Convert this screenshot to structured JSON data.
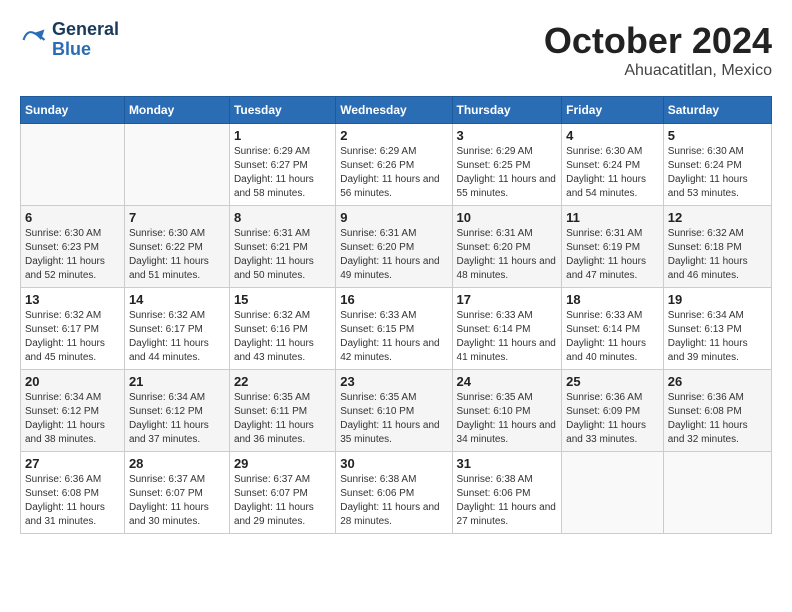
{
  "logo": {
    "line1": "General",
    "line2": "Blue"
  },
  "title": "October 2024",
  "subtitle": "Ahuacatitlan, Mexico",
  "headers": [
    "Sunday",
    "Monday",
    "Tuesday",
    "Wednesday",
    "Thursday",
    "Friday",
    "Saturday"
  ],
  "weeks": [
    [
      {
        "day": "",
        "info": ""
      },
      {
        "day": "",
        "info": ""
      },
      {
        "day": "1",
        "info": "Sunrise: 6:29 AM\nSunset: 6:27 PM\nDaylight: 11 hours and 58 minutes."
      },
      {
        "day": "2",
        "info": "Sunrise: 6:29 AM\nSunset: 6:26 PM\nDaylight: 11 hours and 56 minutes."
      },
      {
        "day": "3",
        "info": "Sunrise: 6:29 AM\nSunset: 6:25 PM\nDaylight: 11 hours and 55 minutes."
      },
      {
        "day": "4",
        "info": "Sunrise: 6:30 AM\nSunset: 6:24 PM\nDaylight: 11 hours and 54 minutes."
      },
      {
        "day": "5",
        "info": "Sunrise: 6:30 AM\nSunset: 6:24 PM\nDaylight: 11 hours and 53 minutes."
      }
    ],
    [
      {
        "day": "6",
        "info": "Sunrise: 6:30 AM\nSunset: 6:23 PM\nDaylight: 11 hours and 52 minutes."
      },
      {
        "day": "7",
        "info": "Sunrise: 6:30 AM\nSunset: 6:22 PM\nDaylight: 11 hours and 51 minutes."
      },
      {
        "day": "8",
        "info": "Sunrise: 6:31 AM\nSunset: 6:21 PM\nDaylight: 11 hours and 50 minutes."
      },
      {
        "day": "9",
        "info": "Sunrise: 6:31 AM\nSunset: 6:20 PM\nDaylight: 11 hours and 49 minutes."
      },
      {
        "day": "10",
        "info": "Sunrise: 6:31 AM\nSunset: 6:20 PM\nDaylight: 11 hours and 48 minutes."
      },
      {
        "day": "11",
        "info": "Sunrise: 6:31 AM\nSunset: 6:19 PM\nDaylight: 11 hours and 47 minutes."
      },
      {
        "day": "12",
        "info": "Sunrise: 6:32 AM\nSunset: 6:18 PM\nDaylight: 11 hours and 46 minutes."
      }
    ],
    [
      {
        "day": "13",
        "info": "Sunrise: 6:32 AM\nSunset: 6:17 PM\nDaylight: 11 hours and 45 minutes."
      },
      {
        "day": "14",
        "info": "Sunrise: 6:32 AM\nSunset: 6:17 PM\nDaylight: 11 hours and 44 minutes."
      },
      {
        "day": "15",
        "info": "Sunrise: 6:32 AM\nSunset: 6:16 PM\nDaylight: 11 hours and 43 minutes."
      },
      {
        "day": "16",
        "info": "Sunrise: 6:33 AM\nSunset: 6:15 PM\nDaylight: 11 hours and 42 minutes."
      },
      {
        "day": "17",
        "info": "Sunrise: 6:33 AM\nSunset: 6:14 PM\nDaylight: 11 hours and 41 minutes."
      },
      {
        "day": "18",
        "info": "Sunrise: 6:33 AM\nSunset: 6:14 PM\nDaylight: 11 hours and 40 minutes."
      },
      {
        "day": "19",
        "info": "Sunrise: 6:34 AM\nSunset: 6:13 PM\nDaylight: 11 hours and 39 minutes."
      }
    ],
    [
      {
        "day": "20",
        "info": "Sunrise: 6:34 AM\nSunset: 6:12 PM\nDaylight: 11 hours and 38 minutes."
      },
      {
        "day": "21",
        "info": "Sunrise: 6:34 AM\nSunset: 6:12 PM\nDaylight: 11 hours and 37 minutes."
      },
      {
        "day": "22",
        "info": "Sunrise: 6:35 AM\nSunset: 6:11 PM\nDaylight: 11 hours and 36 minutes."
      },
      {
        "day": "23",
        "info": "Sunrise: 6:35 AM\nSunset: 6:10 PM\nDaylight: 11 hours and 35 minutes."
      },
      {
        "day": "24",
        "info": "Sunrise: 6:35 AM\nSunset: 6:10 PM\nDaylight: 11 hours and 34 minutes."
      },
      {
        "day": "25",
        "info": "Sunrise: 6:36 AM\nSunset: 6:09 PM\nDaylight: 11 hours and 33 minutes."
      },
      {
        "day": "26",
        "info": "Sunrise: 6:36 AM\nSunset: 6:08 PM\nDaylight: 11 hours and 32 minutes."
      }
    ],
    [
      {
        "day": "27",
        "info": "Sunrise: 6:36 AM\nSunset: 6:08 PM\nDaylight: 11 hours and 31 minutes."
      },
      {
        "day": "28",
        "info": "Sunrise: 6:37 AM\nSunset: 6:07 PM\nDaylight: 11 hours and 30 minutes."
      },
      {
        "day": "29",
        "info": "Sunrise: 6:37 AM\nSunset: 6:07 PM\nDaylight: 11 hours and 29 minutes."
      },
      {
        "day": "30",
        "info": "Sunrise: 6:38 AM\nSunset: 6:06 PM\nDaylight: 11 hours and 28 minutes."
      },
      {
        "day": "31",
        "info": "Sunrise: 6:38 AM\nSunset: 6:06 PM\nDaylight: 11 hours and 27 minutes."
      },
      {
        "day": "",
        "info": ""
      },
      {
        "day": "",
        "info": ""
      }
    ]
  ]
}
